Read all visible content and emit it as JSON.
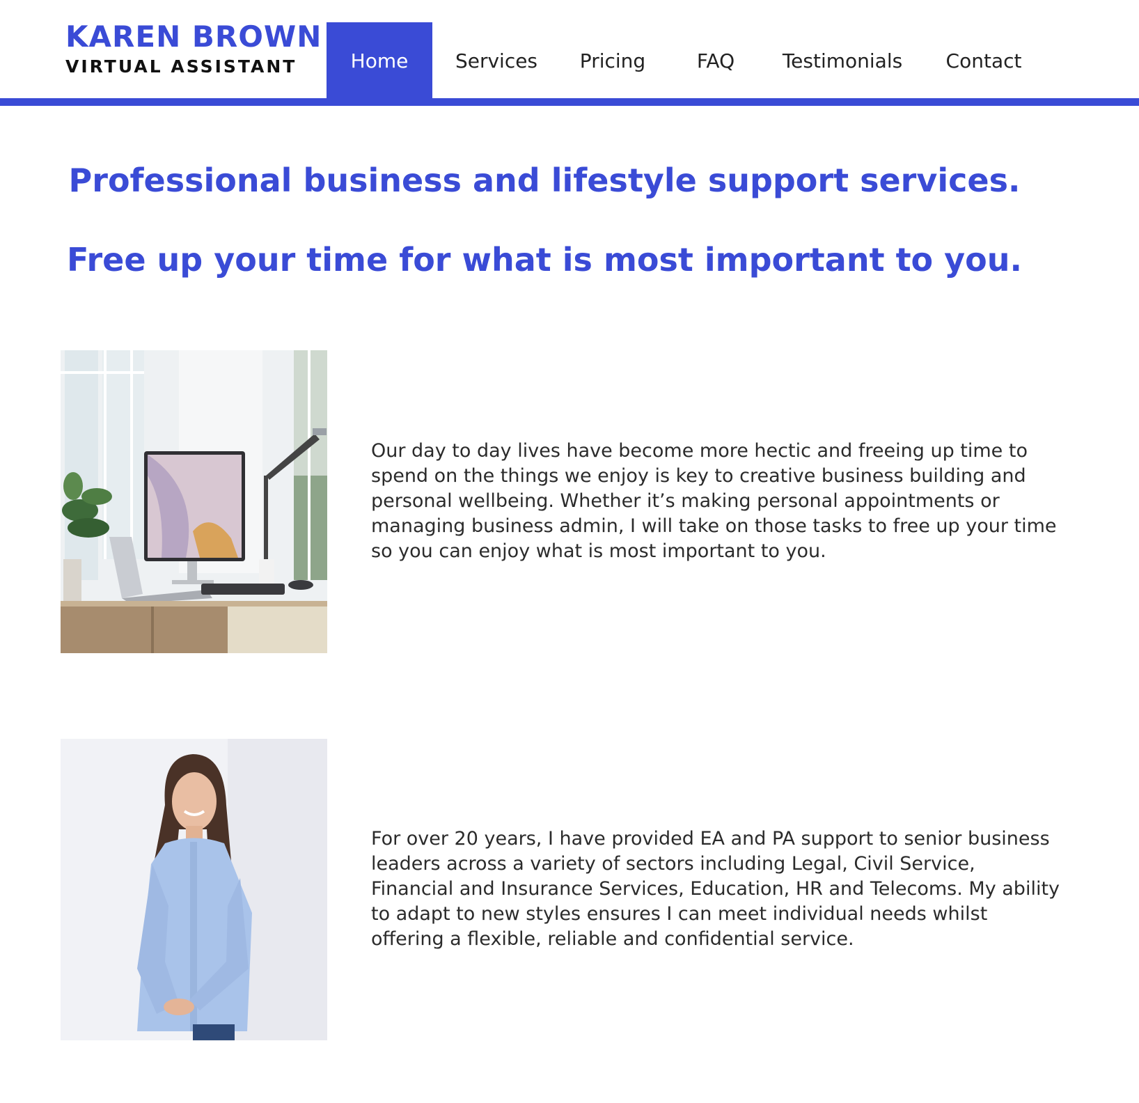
{
  "brand": {
    "name": "KAREN BROWN",
    "tagline": "VIRTUAL ASSISTANT",
    "accent_color": "#3a4bd6"
  },
  "nav": {
    "items": [
      {
        "label": "Home",
        "active": true
      },
      {
        "label": "Services",
        "active": false
      },
      {
        "label": "Pricing",
        "active": false
      },
      {
        "label": "FAQ",
        "active": false
      },
      {
        "label": "Testimonials",
        "active": false
      },
      {
        "label": "Contact",
        "active": false
      }
    ]
  },
  "hero": {
    "line1": "Professional business and lifestyle support services.",
    "line2": "Free up your time for what is most important to you."
  },
  "sections": [
    {
      "image": "home-office-desk-photo",
      "text": "Our day to day lives have become more hectic and freeing up time to spend on the things we enjoy is key to creative business building and personal wellbeing.  Whether it’s making personal appointments or managing business admin, I will take on those tasks to free up your time so you can enjoy what is most important to you."
    },
    {
      "image": "portrait-photo",
      "text": "For over 20 years, I have provided EA and PA support to senior business leaders across a variety of sectors including Legal, Civil Service, Financial and Insurance Services, Education, HR and Telecoms. My ability to adapt to new styles ensures I can meet individual needs whilst offering a flexible, reliable and confidential service."
    }
  ]
}
